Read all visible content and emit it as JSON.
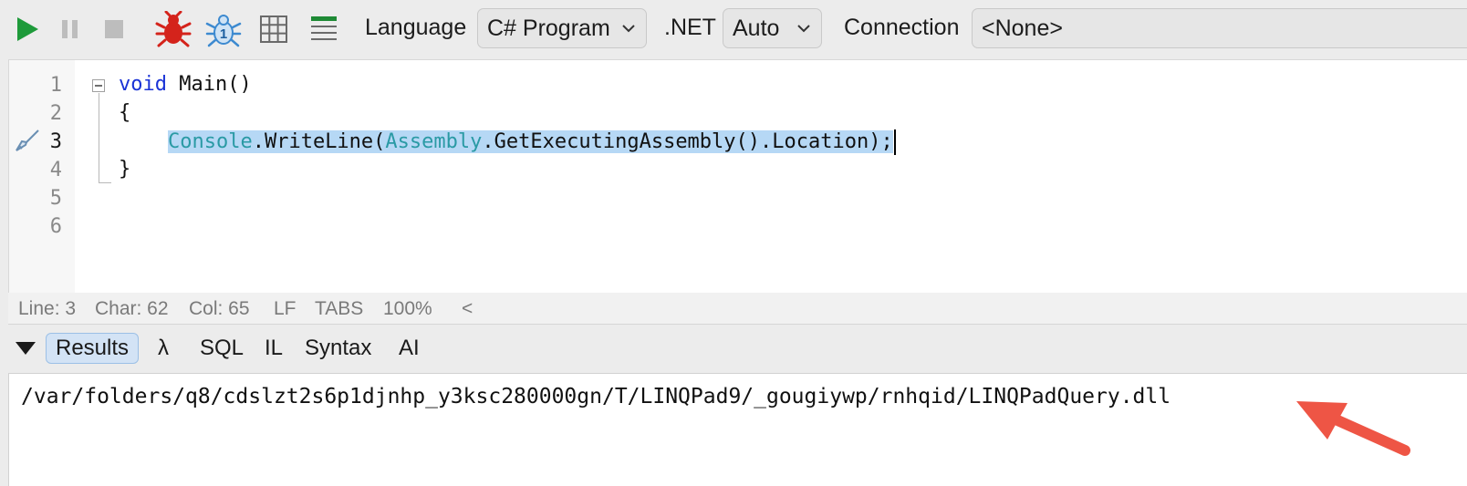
{
  "toolbar": {
    "icons": [
      "run-icon",
      "pause-icon",
      "stop-icon",
      "debug-bug-icon",
      "debug-step-icon",
      "grid-results-icon",
      "text-results-icon"
    ],
    "language_label": "Language",
    "language_value": "C# Program",
    "dotnet_label": ".NET",
    "dotnet_value": "Auto",
    "connection_label": "Connection",
    "connection_value": "<None>"
  },
  "editor": {
    "line_numbers": [
      "1",
      "2",
      "3",
      "4",
      "5",
      "6"
    ],
    "current_line": 3,
    "code": {
      "l1_keyword": "void",
      "l1_rest": " Main()",
      "l2": "{",
      "l3_type1": "Console",
      "l3_mid1": ".WriteLine(",
      "l3_type2": "Assembly",
      "l3_rest": ".GetExecutingAssembly().Location);",
      "l4": "}"
    }
  },
  "status": {
    "line": "Line: 3",
    "char": "Char: 62",
    "col": "Col: 65",
    "eol": "LF",
    "indent": "TABS",
    "zoom": "100%",
    "collapse": "<"
  },
  "results_tabs": {
    "results": "Results",
    "lambda": "λ",
    "sql": "SQL",
    "il": "IL",
    "syntax": "Syntax",
    "ai": "AI"
  },
  "output": {
    "text": "/var/folders/q8/cdslzt2s6p1djnhp_y3ksc280000gn/T/LINQPad9/_gougiywp/rnhqid/LINQPadQuery.dll"
  },
  "colors": {
    "run": "#1e9a3a",
    "bug": "#d4231b",
    "step": "#3d8ad0",
    "selection": "#b6d8f5",
    "arrow": "#ee5545"
  }
}
